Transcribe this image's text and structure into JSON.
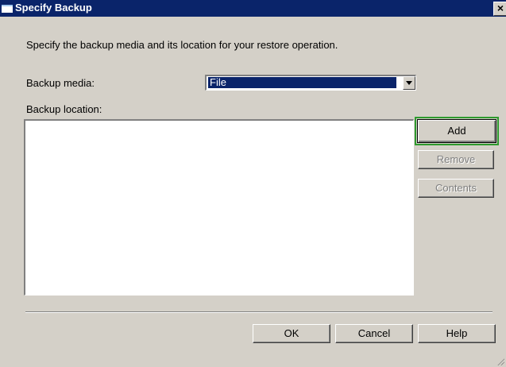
{
  "window": {
    "title": "Specify Backup",
    "close_label": "×"
  },
  "description": "Specify the backup media and its location for your restore operation.",
  "backup_media": {
    "label": "Backup media:",
    "selected": "File"
  },
  "backup_location": {
    "label": "Backup location:",
    "items": []
  },
  "side_buttons": {
    "add": "Add",
    "remove": "Remove",
    "contents": "Contents"
  },
  "footer_buttons": {
    "ok": "OK",
    "cancel": "Cancel",
    "help": "Help"
  },
  "colors": {
    "title_bar": "#0a246a",
    "dialog_bg": "#d4d0c8",
    "highlight": "#2e9a2e"
  }
}
